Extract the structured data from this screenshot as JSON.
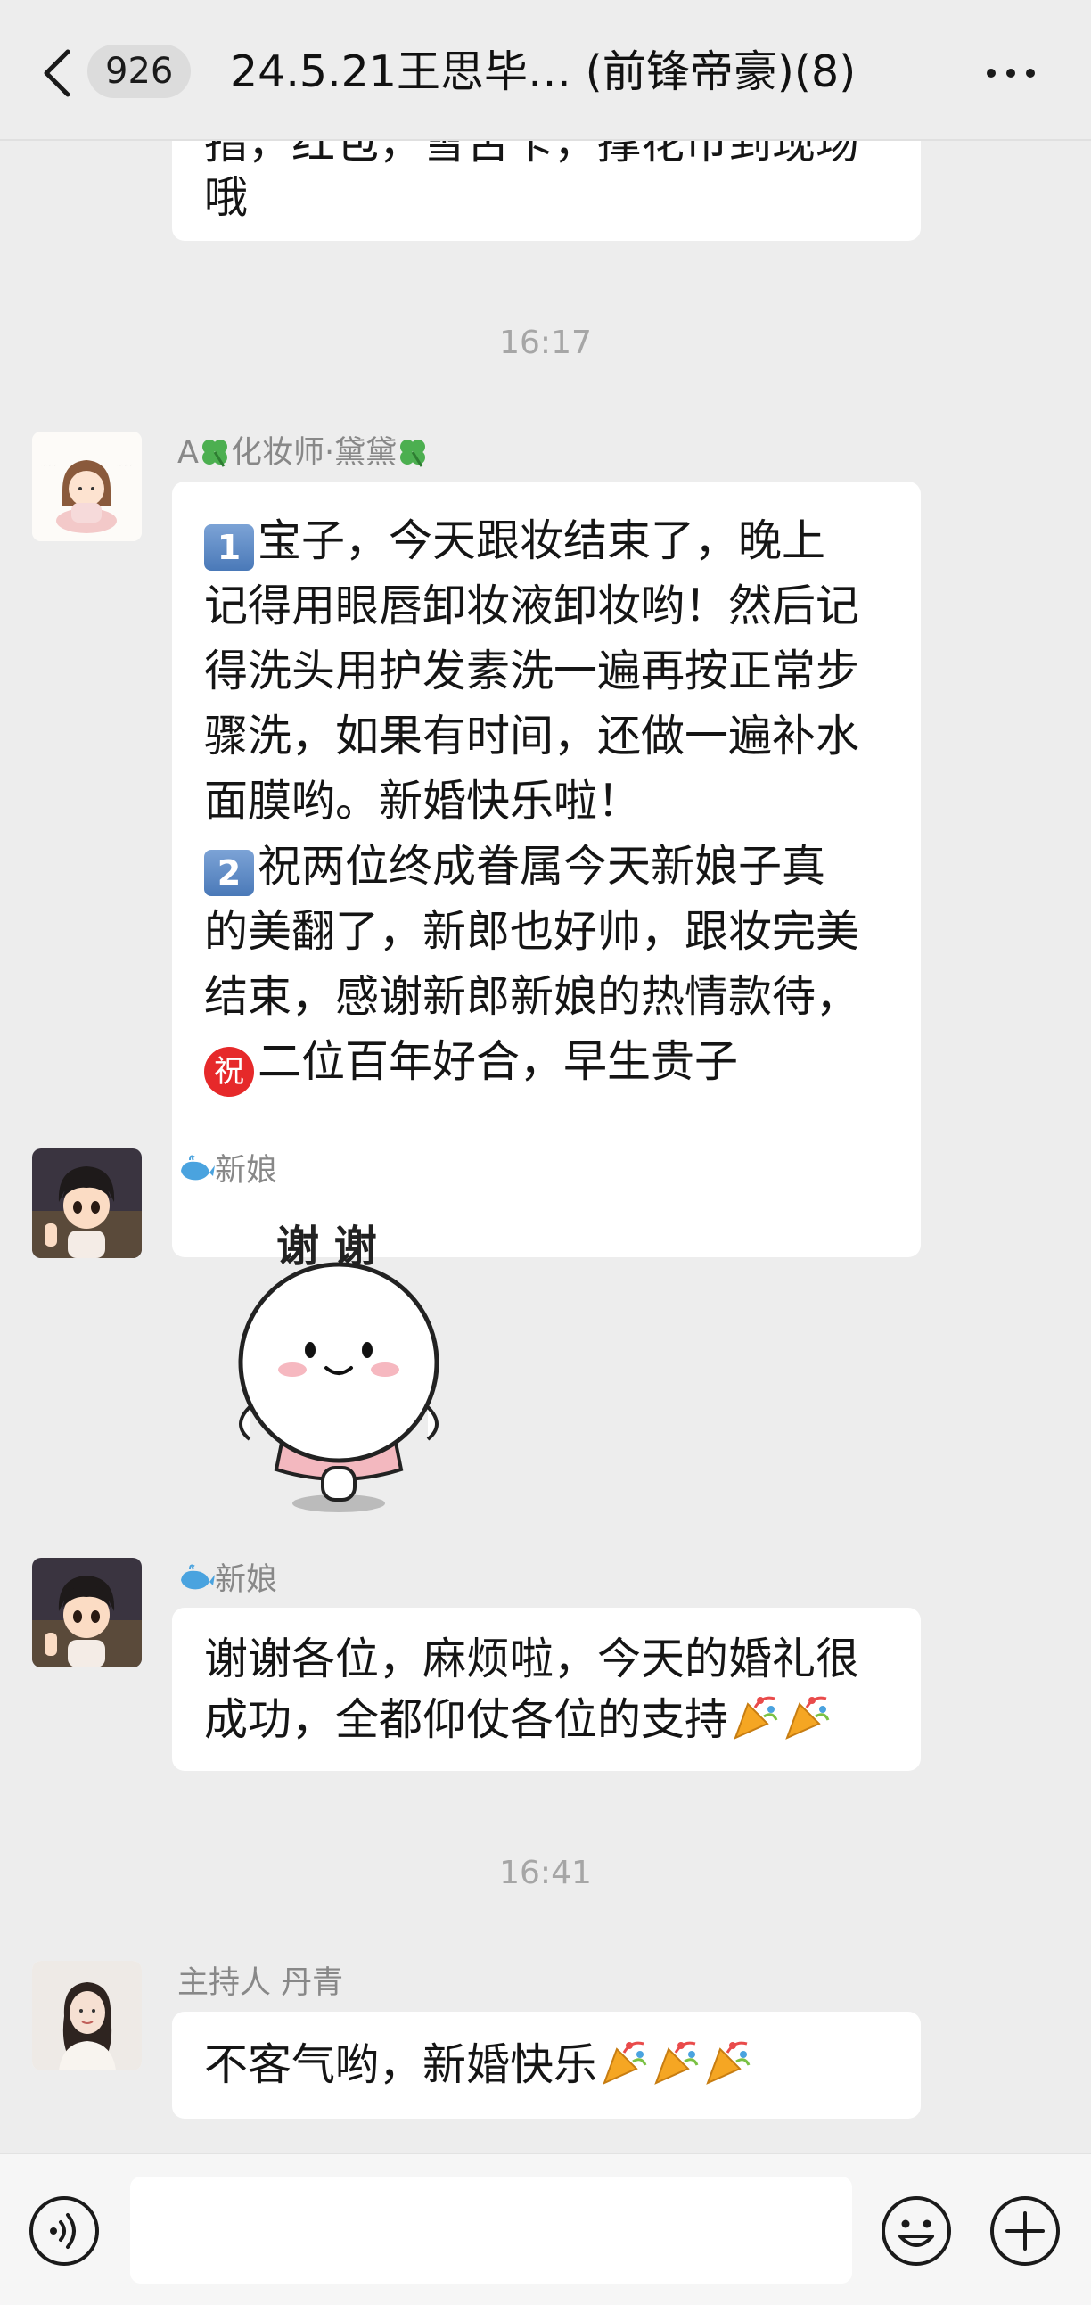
{
  "header": {
    "unread_count": "926",
    "title": "24.5.21王思毕…  (前锋帝豪)(8)"
  },
  "messages": {
    "m0": {
      "line1": "指，红包，雪舌卡，撑花币到现场",
      "line2": "哦"
    },
    "ts1": "16:17",
    "m1": {
      "sender_prefix": "A",
      "sender_name": "化妆师·黛黛",
      "num1": "1",
      "l1": "宝子，今天跟妆结束了，晚上",
      "l2": "记得用眼唇卸妆液卸妆哟！然后记",
      "l3": "得洗头用护发素洗一遍再按正常步",
      "l4": "骤洗，如果有时间，还做一遍补水",
      "l5": "面膜哟。新婚快乐啦！",
      "num2": "2",
      "l6": "祝两位终成眷属今天新娘子真",
      "l7": "的美翻了，新郎也好帅，跟妆完美",
      "l8": "结束，感谢新郎新娘的热情款待，",
      "zhu": "祝",
      "l9": "二位百年好合，早生贵子"
    },
    "m2": {
      "sender": "新娘",
      "sticker_text": "谢 谢"
    },
    "m3": {
      "sender": "新娘",
      "l1": "谢谢各位，麻烦啦，今天的婚礼很",
      "l2": "成功，全都仰仗各位的支持"
    },
    "ts2": "16:41",
    "m4": {
      "sender": "主持人 丹青",
      "l1": "不客气哟，新婚快乐"
    }
  },
  "icons": {
    "back": "chevron-left-icon",
    "more": "more-dots-icon",
    "voice": "voice-icon",
    "emoji": "emoji-icon",
    "plus": "plus-icon",
    "party": "party-popper-icon"
  },
  "colors": {
    "background": "#ededed",
    "bubble": "#ffffff",
    "sender": "#888888"
  }
}
